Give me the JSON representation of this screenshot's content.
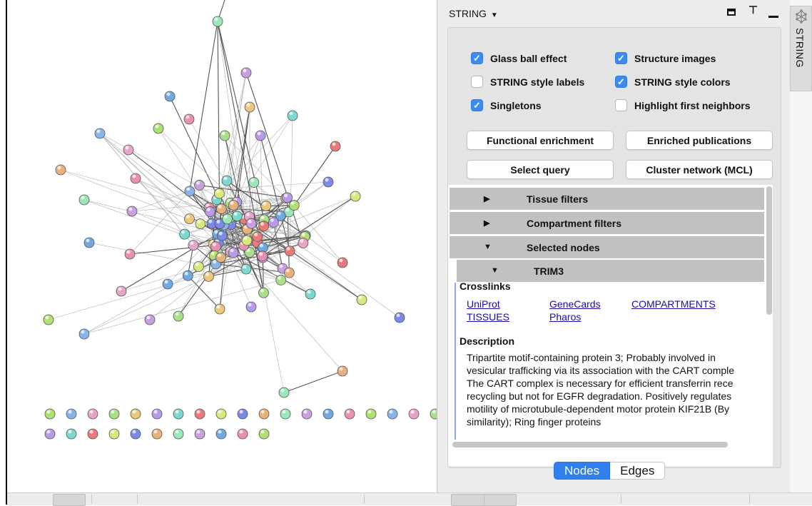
{
  "panel": {
    "title": "STRING",
    "title_caret": "▼"
  },
  "side_tab": {
    "label": "STRING"
  },
  "options": {
    "glass_ball": {
      "label": "Glass ball effect",
      "checked": true
    },
    "structure_images": {
      "label": "Structure images",
      "checked": true
    },
    "string_labels": {
      "label": "STRING style labels",
      "checked": false
    },
    "string_colors": {
      "label": "STRING style colors",
      "checked": true
    },
    "singletons": {
      "label": "Singletons",
      "checked": true
    },
    "highlight_neighbors": {
      "label": "Highlight first neighbors",
      "checked": false
    }
  },
  "buttons": {
    "functional_enrichment": "Functional enrichment",
    "enriched_publications": "Enriched publications",
    "select_query": "Select query",
    "cluster_network": "Cluster network (MCL)"
  },
  "filters": {
    "tissue": "Tissue filters",
    "compartment": "Compartment filters",
    "selected_nodes": "Selected nodes",
    "node_name": "TRIM3"
  },
  "crosslinks": {
    "title": "Crosslinks",
    "uniprot": "UniProt",
    "genecards": "GeneCards",
    "compartments": "COMPARTMENTS",
    "tissues": "TISSUES",
    "pharos": "Pharos"
  },
  "description": {
    "title": "Description",
    "text": "Tripartite motif-containing protein 3; Probably involved in\nvesicular trafficking via its association with the CART comple\nThe CART complex is necessary for efficient transferrin rece\nrecycling but not for EGFR degradation. Positively regulates\nmotility of microtubule-dependent motor protein KIF21B (By\nsimilarity); Ring finger proteins"
  },
  "tabs": {
    "nodes": "Nodes",
    "edges": "Edges"
  },
  "icons": {
    "maximize": "maximize-icon",
    "pin": "pin-icon",
    "minimize": "minimize-icon",
    "string_logo": "string-network-icon"
  },
  "colors": {
    "accent": "#3b8bf0",
    "link": "#1a0dab",
    "filter_header": "#c1c1c1"
  }
}
